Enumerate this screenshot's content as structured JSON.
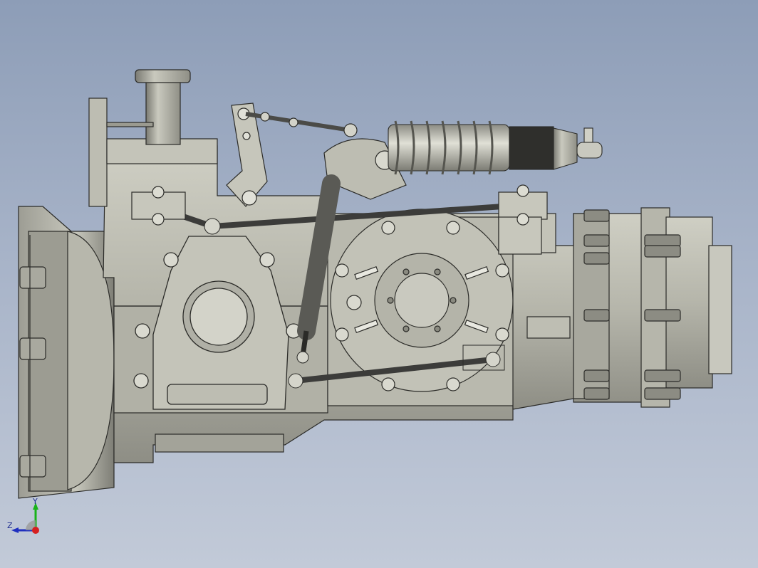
{
  "viewport": {
    "background_top": "#8d9db7",
    "background_bottom": "#c2cad8"
  },
  "model": {
    "part_color": "#b8b8ac",
    "dark_part_color": "#6f6f66",
    "rod_color": "#3c3c3a",
    "spring_color": "#c8c6bc"
  },
  "triad": {
    "x_axis_color": "#d62020",
    "y_axis_color": "#19b319",
    "z_axis_color": "#1f2fbf",
    "y_label": "Y",
    "z_label": "Z"
  }
}
